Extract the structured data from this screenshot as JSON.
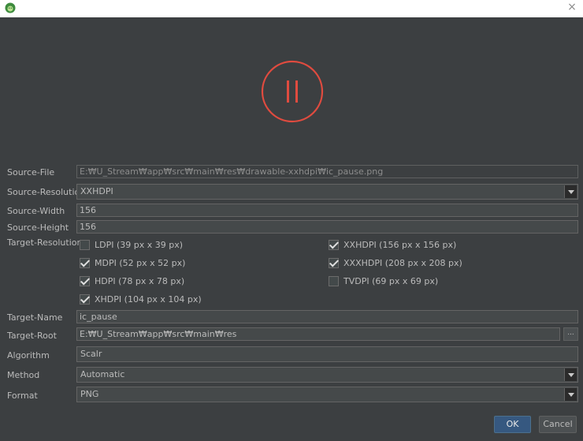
{
  "window": {
    "close_glyph": "×",
    "icon": "android-app-icon"
  },
  "preview": {
    "icon": "pause-icon",
    "color": "#e04b3f"
  },
  "source_file": {
    "label": "Source-File",
    "value": "E:₩U_Stream₩app₩src₩main₩res₩drawable-xxhdpi₩ic_pause.png"
  },
  "source_resolution": {
    "label": "Source-Resolution",
    "value": "XXHDPI"
  },
  "source_width": {
    "label": "Source-Width",
    "value": "156"
  },
  "source_height": {
    "label": "Source-Height",
    "value": "156"
  },
  "target_resolution": {
    "label": "Target-Resolution",
    "options": [
      {
        "label": "LDPI (39 px x 39 px)",
        "checked": false
      },
      {
        "label": "MDPI (52 px x 52 px)",
        "checked": true
      },
      {
        "label": "HDPI (78 px x 78 px)",
        "checked": true
      },
      {
        "label": "XHDPI (104 px x 104 px)",
        "checked": true
      },
      {
        "label": "XXHDPI (156 px x 156 px)",
        "checked": true
      },
      {
        "label": "XXXHDPI (208 px x 208 px)",
        "checked": true
      },
      {
        "label": "TVDPI (69 px x 69 px)",
        "checked": false
      }
    ]
  },
  "target_name": {
    "label": "Target-Name",
    "value": "ic_pause"
  },
  "target_root": {
    "label": "Target-Root",
    "value": "E:₩U_Stream₩app₩src₩main₩res",
    "browse_label": "..."
  },
  "algorithm": {
    "label": "Algorithm",
    "value": "Scalr"
  },
  "method": {
    "label": "Method",
    "value": "Automatic"
  },
  "format": {
    "label": "Format",
    "value": "PNG"
  },
  "buttons": {
    "ok": "OK",
    "cancel": "Cancel"
  }
}
